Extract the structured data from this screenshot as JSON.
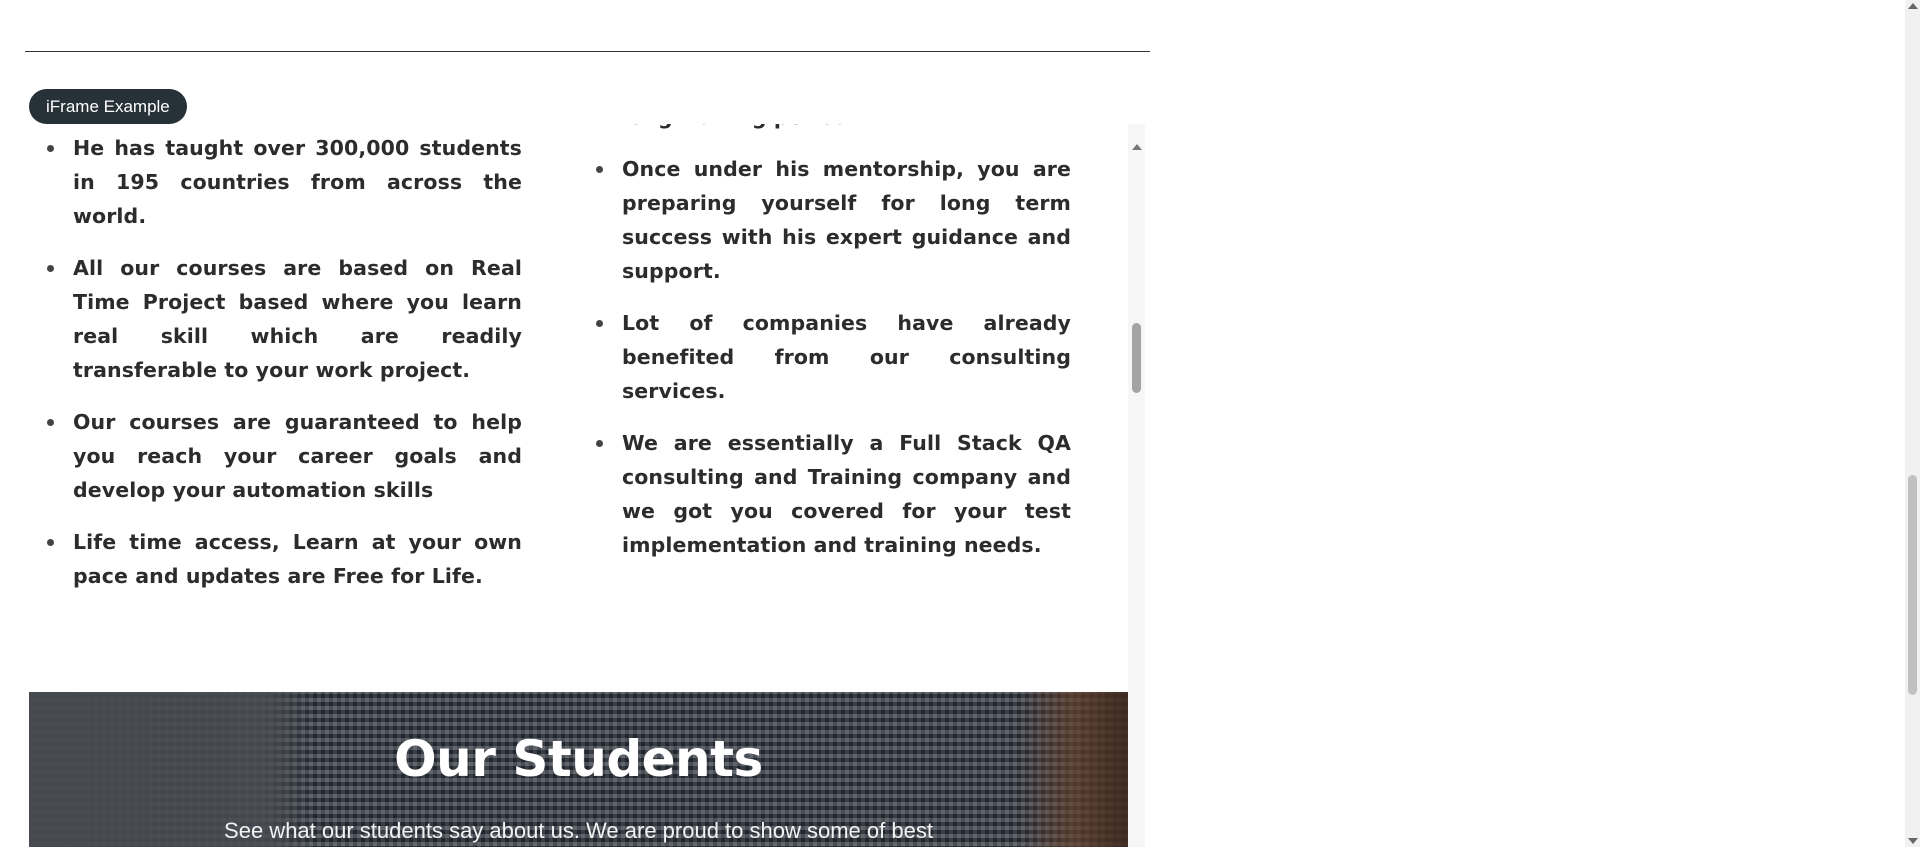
{
  "legend": {
    "label": "iFrame Example"
  },
  "iframe": {
    "left_list": [
      "He has taught over 300,000 students in 195 countries from across the world.",
      "All our courses are based on Real Time Project based where you learn real skill which are readily transferable to your work project.",
      "Our courses are guaranteed to help you reach your career goals and develop your automation skills",
      "Life time access, Learn at your own pace and updates are Free for Life."
    ],
    "right_list": [
      "long waiting period.",
      "Once under his mentorship, you are preparing yourself for long term success with his expert guidance and support.",
      "Lot of companies have already benefited from our consulting services.",
      "We are essentially a Full Stack QA consulting and Training company and we got you covered for your test implementation and training needs."
    ],
    "students": {
      "title": "Our Students",
      "subtitle": "See what our students say about us. We are proud to show some of best"
    }
  }
}
